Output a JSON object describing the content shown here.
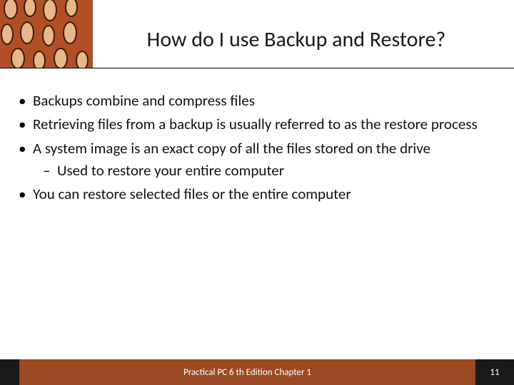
{
  "title": "How do I use Backup and Restore?",
  "bullets": [
    {
      "text": "Backups combine and compress files"
    },
    {
      "text": "Retrieving files from a backup is usually referred to as the restore process"
    },
    {
      "text": "A system image is an exact copy of all the files stored on the drive",
      "sub": [
        "Used to restore your entire computer"
      ]
    },
    {
      "text": "You can restore selected files or the entire computer"
    }
  ],
  "footer": {
    "text": "Practical PC 6 th Edition Chapter 1",
    "page": "11"
  }
}
